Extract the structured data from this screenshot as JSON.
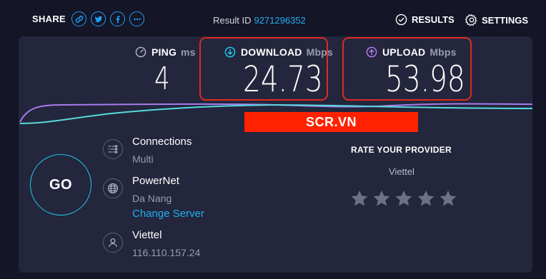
{
  "header": {
    "share_label": "SHARE",
    "share_icons": [
      "link-icon",
      "twitter-icon",
      "facebook-icon",
      "more-icon"
    ],
    "result_label": "Result ID",
    "result_id": "9271296352",
    "results_label": "RESULTS",
    "settings_label": "SETTINGS"
  },
  "metrics": {
    "ping": {
      "label": "PING",
      "unit": "ms",
      "value": "4"
    },
    "download": {
      "label": "DOWNLOAD",
      "unit": "Mbps",
      "value": "24.73"
    },
    "upload": {
      "label": "UPLOAD",
      "unit": "Mbps",
      "value": "53.98"
    }
  },
  "watermark": "SCR.VN",
  "go_label": "GO",
  "connections": {
    "title": "Connections",
    "value": "Multi"
  },
  "server": {
    "name": "PowerNet",
    "location": "Da Nang",
    "change_label": "Change Server"
  },
  "isp": {
    "name": "Viettel",
    "ip": "116.110.157.24"
  },
  "rating": {
    "title": "RATE YOUR PROVIDER",
    "provider": "Viettel",
    "stars": 5
  },
  "colors": {
    "accent": "#1f9ef5",
    "download": "#21c8e8",
    "upload": "#b07cf0",
    "highlight": "#e02a1f",
    "watermark_bg": "#ff2200"
  }
}
